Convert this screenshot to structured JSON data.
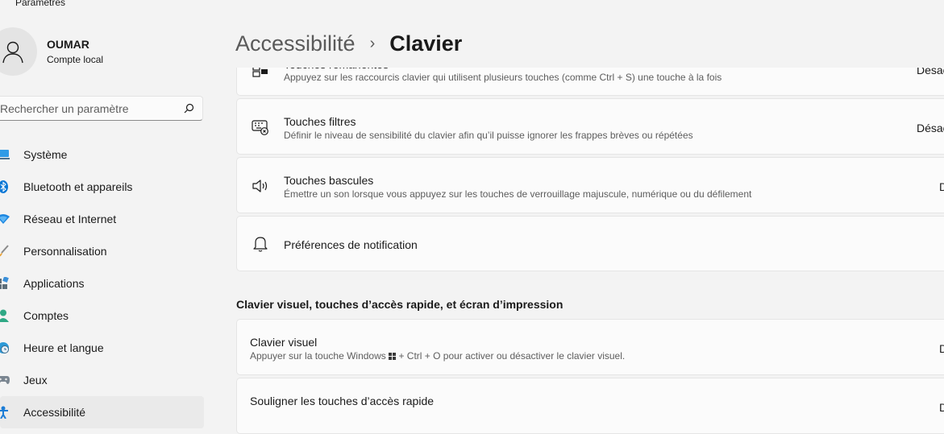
{
  "app": {
    "title": "Paramètres"
  },
  "user": {
    "name": "OUMAR",
    "account_type": "Compte local"
  },
  "search": {
    "placeholder": "Rechercher un paramètre"
  },
  "sidebar": {
    "items": [
      {
        "label": "Système",
        "icon": "system-icon"
      },
      {
        "label": "Bluetooth et appareils",
        "icon": "bluetooth-icon"
      },
      {
        "label": "Réseau et Internet",
        "icon": "wifi-icon"
      },
      {
        "label": "Personnalisation",
        "icon": "brush-icon"
      },
      {
        "label": "Applications",
        "icon": "apps-icon"
      },
      {
        "label": "Comptes",
        "icon": "person-icon"
      },
      {
        "label": "Heure et langue",
        "icon": "clock-globe-icon"
      },
      {
        "label": "Jeux",
        "icon": "gamepad-icon"
      },
      {
        "label": "Accessibilité",
        "icon": "accessibility-icon",
        "active": true
      }
    ]
  },
  "header": {
    "parent": "Accessibilité",
    "separator": "›",
    "current": "Clavier"
  },
  "cards": {
    "sticky": {
      "title": "Touches rémanentes",
      "description": "Appuyez sur les raccourcis clavier qui utilisent plusieurs touches (comme Ctrl + S) une touche à la fois",
      "state": "Désactivé"
    },
    "filter": {
      "title": "Touches filtres",
      "description": "Définir le niveau de sensibilité du clavier afin qu’il puisse ignorer les frappes brèves ou répétées",
      "state": "Désactivé"
    },
    "toggle": {
      "title": "Touches bascules",
      "description": "Émettre un son lorsque vous appuyez sur les touches de verrouillage majuscule, numérique ou du défilement",
      "state": "Désactivé"
    },
    "notifications": {
      "title": "Préférences de notification"
    }
  },
  "section": {
    "title": "Clavier visuel, touches d’accès rapide, et écran d’impression"
  },
  "visual_keyboard": {
    "title": "Clavier visuel",
    "description_before": "Appuyer sur la touche Windows",
    "description_after": "+ Ctrl + O pour activer ou désactiver le clavier visuel.",
    "state": "Désactivé"
  },
  "underline": {
    "title": "Souligner les touches d’accès rapide",
    "state": "Désactivé"
  },
  "colors": {
    "accent": "#0067c0",
    "window_bg": "#f3f3f3",
    "card_bg": "#fbfbfb"
  }
}
